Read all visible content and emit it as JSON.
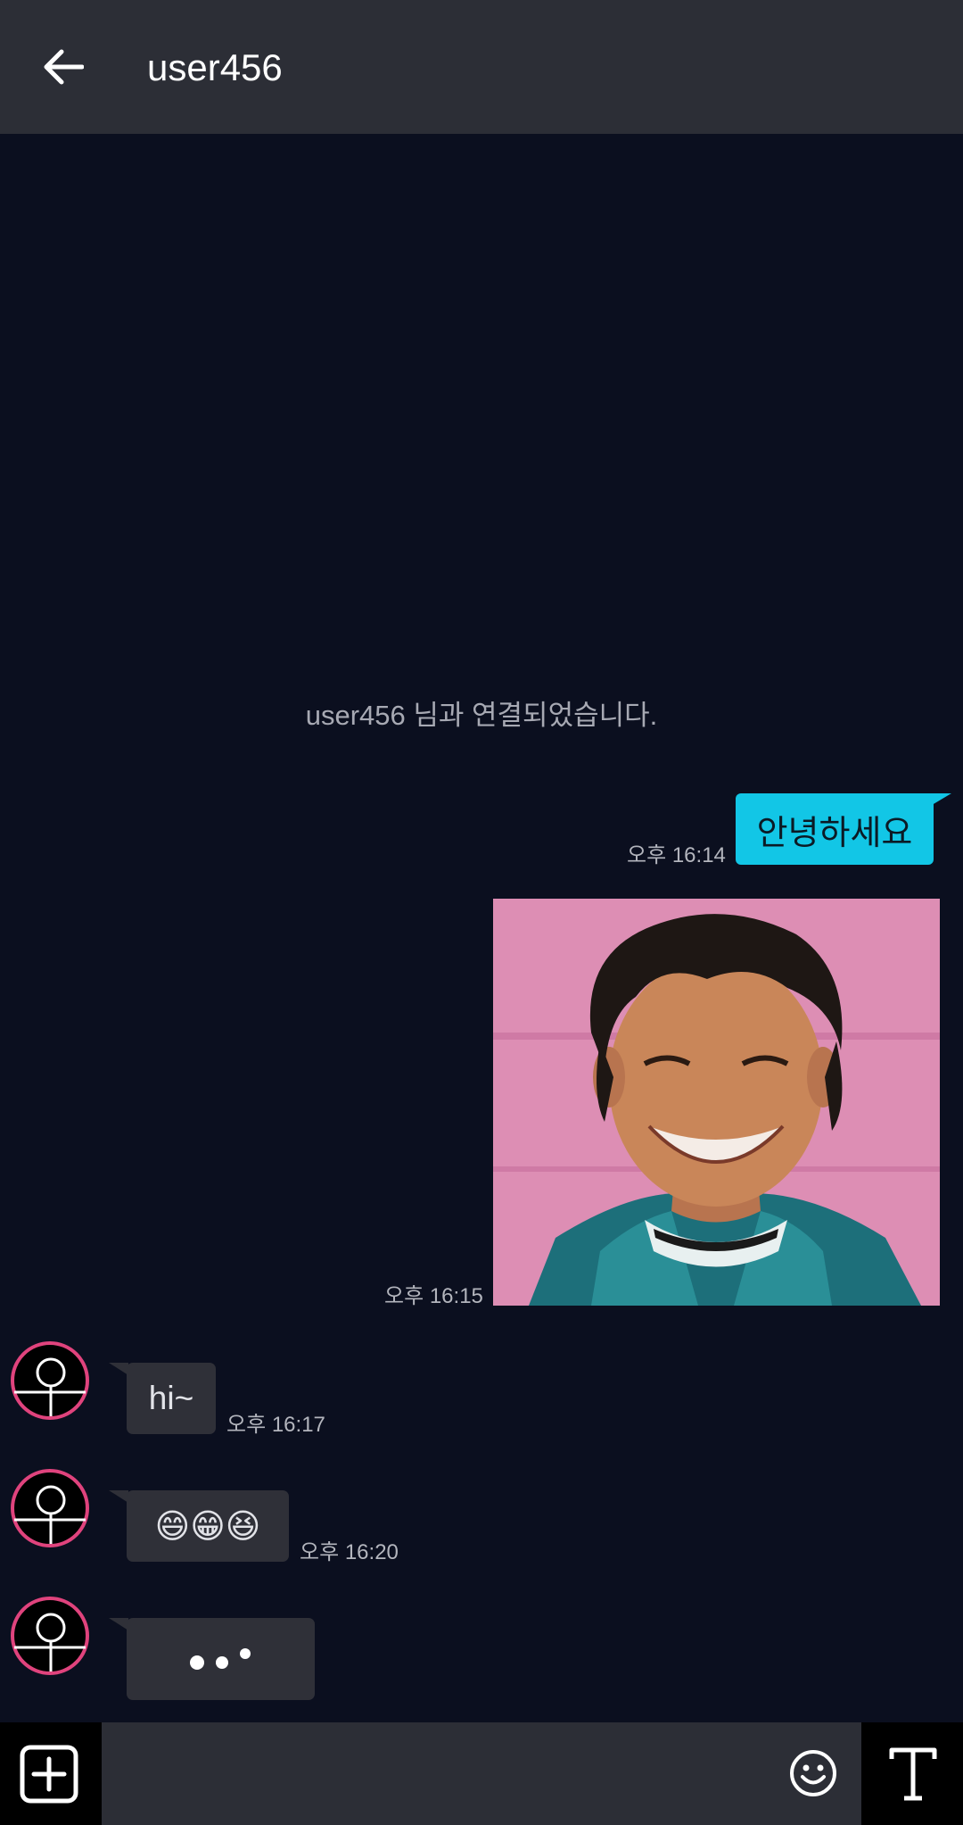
{
  "header": {
    "title": "user456"
  },
  "system_message": "user456 님과 연결되었습니다.",
  "messages": {
    "sent_text": {
      "text": "안녕하세요",
      "time": "오후 16:14"
    },
    "sent_photo": {
      "time": "오후 16:15"
    },
    "recv_1": {
      "text": "hi~",
      "time": "오후 16:17"
    },
    "recv_2": {
      "text": "😄😁😆",
      "time": "오후 16:20"
    },
    "recv_3": {
      "text": "typing"
    }
  },
  "colors": {
    "background": "#0b0f1f",
    "header": "#2c2e36",
    "sent_bubble": "#12c6e6",
    "recv_bubble": "#2f3038",
    "avatar_ring": "#e0437d"
  },
  "icons": {
    "back": "arrow-left-icon",
    "add": "plus-square-icon",
    "emoji": "smiley-icon",
    "text_style": "text-t-icon"
  },
  "input": {
    "value": "",
    "placeholder": ""
  }
}
